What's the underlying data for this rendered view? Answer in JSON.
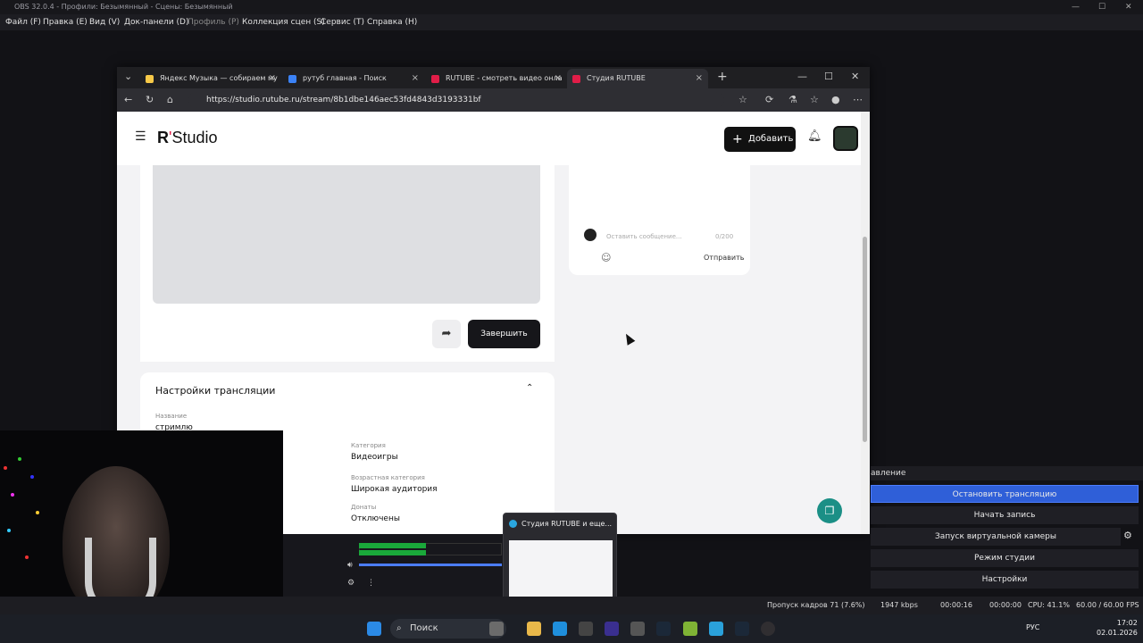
{
  "obs": {
    "title": "OBS 32.0.4 - Профили: Безымянный - Сцены: Безымянный",
    "menu": [
      "Файл (F)",
      "Правка (E)",
      "Вид (V)",
      "Док-панели (D)",
      "Профиль (P)",
      "Коллекция сцен (S)",
      "Сервис (T)",
      "Справка (H)"
    ],
    "controls_title": "авление",
    "controls": [
      "Остановить трансляцию",
      "Начать запись",
      "Запуск виртуальной камеры",
      "Режим студии",
      "Настройки"
    ],
    "status": {
      "dropped": "Пропуск кадров 71 (7.6%)",
      "bitrate": "1947 kbps",
      "stream_time": "00:00:16",
      "rec_time": "00:00:00",
      "cpu": "CPU: 41.1%",
      "fps": "60.00 / 60.00 FPS"
    }
  },
  "browser": {
    "tabs": [
      {
        "label": "Яндекс Музыка — собираем му",
        "color": "#f7c948"
      },
      {
        "label": "рутуб главная - Поиск",
        "color": "#3b82f6"
      },
      {
        "label": "RUTUBE - смотреть видео онла",
        "color": "#e11d48"
      },
      {
        "label": "Студия RUTUBE",
        "color": "#e11d48"
      }
    ],
    "url": "https://studio.rutube.ru/stream/8b1dbe146aec53fd4843d3193331bf"
  },
  "site": {
    "logo_r": "R",
    "logo_text": "Studio",
    "add_label": "Добавить",
    "finish_label": "Завершить",
    "chat_placeholder": "Оставить сообщение...",
    "chat_counter": "0/200",
    "send_label": "Отправить",
    "settings_title": "Настройки трансляции",
    "name_label": "Название",
    "name_value": "стримлю",
    "category_label": "Категория",
    "category_value": "Видеоигры",
    "age_label": "Возрастная категория",
    "age_value": "Широкая аудитория",
    "donations_label": "Донаты",
    "donations_value": "Отключены"
  },
  "thumbnail": {
    "title": "Студия RUTUBE и еще..."
  },
  "taskbar": {
    "search": "Поиск",
    "lang": "РУС",
    "time": "17:02",
    "date": "02.01.2026"
  }
}
